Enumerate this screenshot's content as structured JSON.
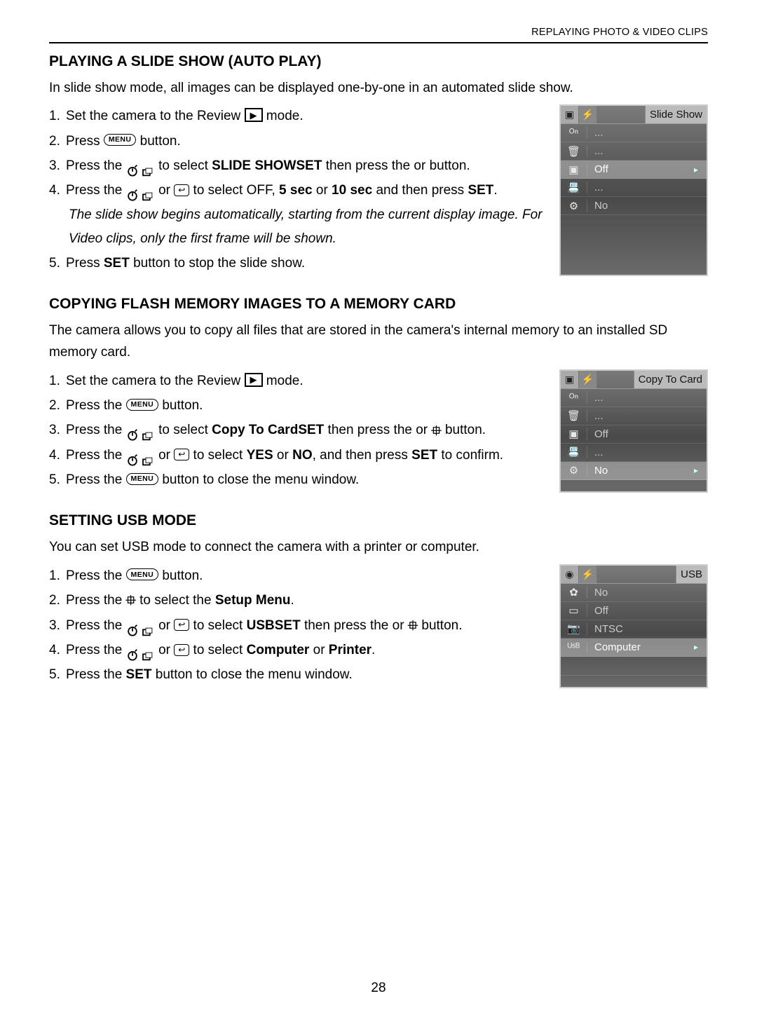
{
  "header": "REPLAYING PHOTO & VIDEO CLIPS",
  "page_number": "28",
  "icons": {
    "review": "▶",
    "menu": "MENU",
    "return": "↩",
    "flash": "⯐",
    "arrow": "▸"
  },
  "sections": [
    {
      "title": "PLAYING A SLIDE SHOW (AUTO PLAY)",
      "intro": "In slide show mode, all images can be displayed one-by-one in an automated slide show.",
      "steps": [
        {
          "pre": "Set the camera to the Review ",
          "icon": "review",
          "post": " mode."
        },
        {
          "pre": "Press ",
          "icon": "menu",
          "post": " button."
        },
        {
          "pre": "Press the ",
          "icon": "timerburst",
          "mid": " to select ",
          "bold1": "SLIDE SHOW",
          "post1": " then press the ",
          "bold2": "SET",
          "post2": " or button."
        },
        {
          "pre": "Press the ",
          "icon": "timerburst_return",
          "mid": " to select OFF, ",
          "bold1": "5 sec",
          "mid2": " or ",
          "bold2": "10 sec",
          "post1": " and then press ",
          "bold3": "SET",
          "post2": "."
        },
        {
          "italic": "The slide show begins automatically, starting from the current display image. For Video clips, only the first frame will be shown."
        },
        {
          "pre": "Press ",
          "bold1": "SET",
          "post1": " button to stop the slide show."
        }
      ],
      "lcd": {
        "top_tabs": [
          "▣",
          "⚡"
        ],
        "top_label": "Slide Show",
        "rows": [
          {
            "icon": "ᴼⁿ",
            "val": "..."
          },
          {
            "icon": "🗑",
            "val": "..."
          },
          {
            "icon": "▣",
            "val": "Off",
            "sel": true
          },
          {
            "icon": "📇",
            "val": "..."
          },
          {
            "icon": "⚙",
            "val": "No"
          }
        ]
      }
    },
    {
      "title": "COPYING FLASH MEMORY IMAGES TO A MEMORY CARD",
      "intro": "The camera allows you to copy all files that are stored in the camera's internal memory to an installed SD memory card.",
      "steps": [
        {
          "pre": "Set the camera to the Review ",
          "icon": "review",
          "post": " mode."
        },
        {
          "pre": "Press the ",
          "icon": "menu",
          "post": " button."
        },
        {
          "pre": "Press the ",
          "icon": "timerburst",
          "mid": " to select ",
          "bold1": "Copy To Card",
          "post1": " then press the ",
          "bold2": "SET",
          "post2": " or ",
          "icon2": "flash",
          "post3": " button."
        },
        {
          "pre": "Press the ",
          "icon": "timerburst_return",
          "mid": " to select ",
          "bold1": "YES",
          "mid2": " or ",
          "bold2": "NO",
          "post1": ", and then press ",
          "bold3": "SET",
          "post2": " to confirm."
        },
        {
          "pre": "Press the ",
          "icon": "menu",
          "post": " button to close the menu window."
        }
      ],
      "lcd": {
        "top_tabs": [
          "▣",
          "⚡"
        ],
        "top_label": "Copy To Card",
        "rows": [
          {
            "icon": "ᴼⁿ",
            "val": "..."
          },
          {
            "icon": "🗑",
            "val": "..."
          },
          {
            "icon": "▣",
            "val": "Off"
          },
          {
            "icon": "📇",
            "val": "..."
          },
          {
            "icon": "⚙",
            "val": "No",
            "sel": true
          }
        ]
      }
    },
    {
      "title": "SETTING USB MODE",
      "intro": "You can set USB mode to connect the camera with a printer or computer.",
      "steps": [
        {
          "pre": "Press the ",
          "icon": "menu",
          "post": " button."
        },
        {
          "pre": "Press the ",
          "icon": "flash",
          "mid": " to select the ",
          "bold1": "Setup Menu",
          "post1": "."
        },
        {
          "pre": "Press the ",
          "icon": "timerburst_return",
          "mid": " to select ",
          "bold1": "USB",
          "post1": " then press the ",
          "bold2": "SET",
          "post2": " or ",
          "icon2": "flash",
          "post3": " button."
        },
        {
          "pre": "Press the ",
          "icon": "timerburst_return",
          "mid": " to select ",
          "bold1": "Computer",
          "mid2": " or ",
          "bold2": "Printer",
          "post1": "."
        },
        {
          "pre": "Press the ",
          "bold1": "SET",
          "post1": " button to close the menu window."
        }
      ],
      "lcd": {
        "top_tabs": [
          "◉",
          "⚡"
        ],
        "top_label": "USB",
        "rows": [
          {
            "icon": "✿",
            "val": "No"
          },
          {
            "icon": "▭",
            "val": "Off"
          },
          {
            "icon": "📷",
            "val": "NTSC"
          },
          {
            "icon": "ᵁˢᴮ",
            "val": "Computer",
            "sel": true
          },
          {
            "icon": "",
            "val": "",
            "empty": true
          }
        ]
      }
    }
  ]
}
